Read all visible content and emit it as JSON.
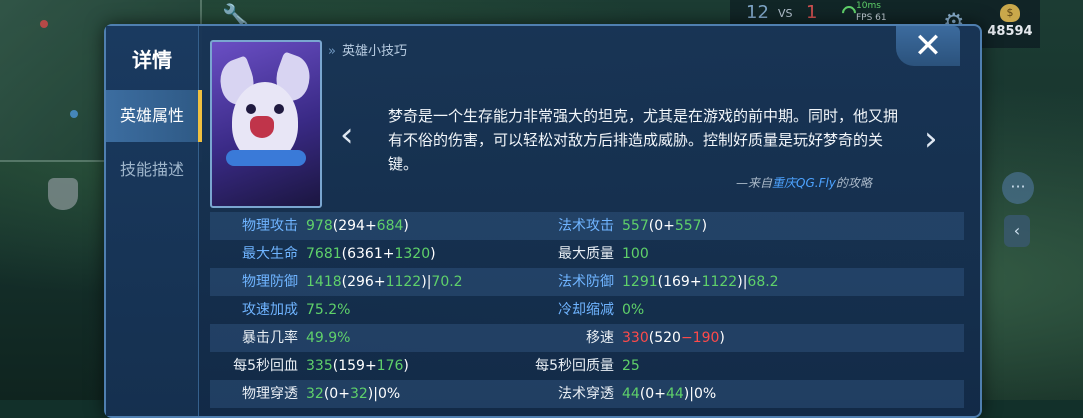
{
  "hud": {
    "score_left": "12",
    "vs": "VS",
    "score_right": "1",
    "ping": "10ms",
    "fps": "FPS 61",
    "gold": "48594",
    "gold_icon": "coin-bag-icon"
  },
  "dialog": {
    "title": "详情",
    "tabs": [
      {
        "label": "英雄属性",
        "active": true
      },
      {
        "label": "技能描述",
        "active": false
      }
    ],
    "close_label": "✕",
    "tip_header": "英雄小技巧",
    "tip_text": "梦奇是一个生存能力非常强大的坦克，尤其是在游戏的前中期。同时，他又拥有不俗的伤害，可以轻松对敌方后排造成威胁。控制好质量是玩好梦奇的关键。",
    "tip_source_prefix": "—来自",
    "tip_source_author": "重庆QG.Fly",
    "tip_source_suffix": "的攻略"
  },
  "stats": [
    {
      "left": {
        "label": "物理攻击",
        "base": "978",
        "a": "294",
        "b": "684",
        "extra": ""
      },
      "right": {
        "label": "法术攻击",
        "base": "557",
        "a": "0",
        "b": "557",
        "extra": ""
      }
    },
    {
      "left": {
        "label": "最大生命",
        "base": "7681",
        "a": "6361",
        "b": "1320",
        "extra": ""
      },
      "right": {
        "label": "最大质量",
        "base": "100",
        "a": "",
        "b": "",
        "extra": ""
      }
    },
    {
      "left": {
        "label": "物理防御",
        "base": "1418",
        "a": "296",
        "b": "1122",
        "extra": "70.2"
      },
      "right": {
        "label": "法术防御",
        "base": "1291",
        "a": "169",
        "b": "1122",
        "extra": "68.2"
      }
    },
    {
      "left": {
        "label": "攻速加成",
        "base": "75.2%",
        "a": "",
        "b": "",
        "extra": ""
      },
      "right": {
        "label": "冷却缩减",
        "base": "0%",
        "a": "",
        "b": "",
        "extra": ""
      }
    },
    {
      "left": {
        "label": "暴击几率",
        "base": "49.9%",
        "a": "",
        "b": "",
        "extra": ""
      },
      "right": {
        "label": "移速",
        "base": "330",
        "a": "520",
        "b": "190",
        "extra": ""
      }
    },
    {
      "left": {
        "label": "每5秒回血",
        "base": "335",
        "a": "159",
        "b": "176",
        "extra": ""
      },
      "right": {
        "label": "每5秒回质量",
        "base": "25",
        "a": "",
        "b": "",
        "extra": ""
      }
    },
    {
      "left": {
        "label": "物理穿透",
        "base": "32",
        "a": "0",
        "b": "32",
        "extra": "0%"
      },
      "right": {
        "label": "法术穿透",
        "base": "44",
        "a": "0",
        "b": "44",
        "extra": "0%"
      }
    }
  ]
}
